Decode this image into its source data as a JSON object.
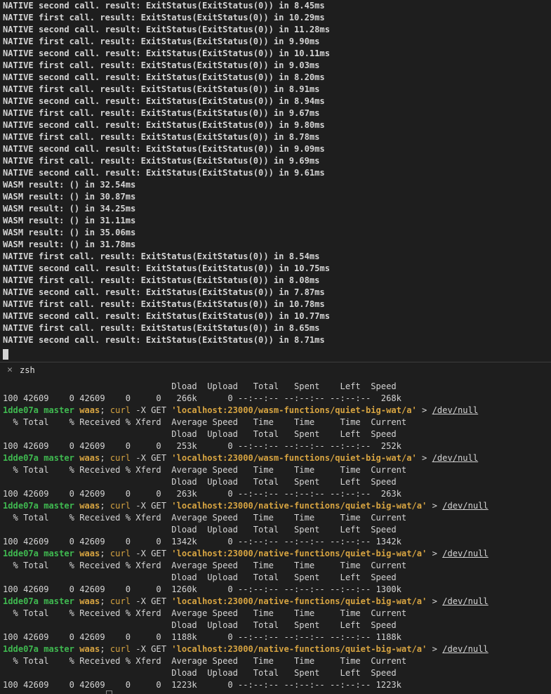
{
  "log_lines": [
    "NATIVE second call. result: ExitStatus(ExitStatus(0)) in 8.45ms",
    "NATIVE first call. result: ExitStatus(ExitStatus(0)) in 10.29ms",
    "NATIVE second call. result: ExitStatus(ExitStatus(0)) in 11.28ms",
    "NATIVE first call. result: ExitStatus(ExitStatus(0)) in 9.90ms",
    "NATIVE second call. result: ExitStatus(ExitStatus(0)) in 10.11ms",
    "NATIVE first call. result: ExitStatus(ExitStatus(0)) in 9.03ms",
    "NATIVE second call. result: ExitStatus(ExitStatus(0)) in 8.20ms",
    "NATIVE first call. result: ExitStatus(ExitStatus(0)) in 8.91ms",
    "NATIVE second call. result: ExitStatus(ExitStatus(0)) in 8.94ms",
    "NATIVE first call. result: ExitStatus(ExitStatus(0)) in 9.67ms",
    "NATIVE second call. result: ExitStatus(ExitStatus(0)) in 9.80ms",
    "NATIVE first call. result: ExitStatus(ExitStatus(0)) in 8.78ms",
    "NATIVE second call. result: ExitStatus(ExitStatus(0)) in 9.09ms",
    "NATIVE first call. result: ExitStatus(ExitStatus(0)) in 9.69ms",
    "NATIVE second call. result: ExitStatus(ExitStatus(0)) in 9.61ms",
    "WASM result: () in 32.54ms",
    "WASM result: () in 30.87ms",
    "WASM result: () in 34.25ms",
    "WASM result: () in 31.11ms",
    "WASM result: () in 35.06ms",
    "WASM result: () in 31.78ms",
    "NATIVE first call. result: ExitStatus(ExitStatus(0)) in 8.54ms",
    "NATIVE second call. result: ExitStatus(ExitStatus(0)) in 10.75ms",
    "NATIVE first call. result: ExitStatus(ExitStatus(0)) in 8.08ms",
    "NATIVE second call. result: ExitStatus(ExitStatus(0)) in 7.87ms",
    "NATIVE first call. result: ExitStatus(ExitStatus(0)) in 10.78ms",
    "NATIVE second call. result: ExitStatus(ExitStatus(0)) in 10.77ms",
    "NATIVE first call. result: ExitStatus(ExitStatus(0)) in 8.65ms",
    "NATIVE second call. result: ExitStatus(ExitStatus(0)) in 8.71ms"
  ],
  "terminal_tab": {
    "label": "zsh",
    "close_icon": "close-icon"
  },
  "curl_header_1": "  % Total    % Received % Xferd  Average Speed   Time    Time     Time  Current",
  "curl_header_2": "                                 Dload  Upload   Total   Spent    Left  Speed",
  "prompt": {
    "hash": "1dde07a",
    "branch": "master",
    "dir": "waas",
    "semicolon": ";",
    "cmd": "curl",
    "args": " -X GET ",
    "redirect": " > ",
    "target": "/dev/null"
  },
  "urls": [
    "'localhost:23000/wasm-functions/quiet-big-wat/a'",
    "'localhost:23000/wasm-functions/quiet-big-wat/a'",
    "'localhost:23000/native-functions/quiet-big-wat/a'",
    "'localhost:23000/native-functions/quiet-big-wat/a'",
    "'localhost:23000/native-functions/quiet-big-wat/a'",
    "'localhost:23000/native-functions/quiet-big-wat/a'"
  ],
  "progress_rows": [
    "100 42609    0 42609    0     0   266k      0 --:--:-- --:--:-- --:--:--  268k",
    "100 42609    0 42609    0     0   253k      0 --:--:-- --:--:-- --:--:--  252k",
    "100 42609    0 42609    0     0   263k      0 --:--:-- --:--:-- --:--:--  263k",
    "100 42609    0 42609    0     0  1342k      0 --:--:-- --:--:-- --:--:-- 1342k",
    "100 42609    0 42609    0     0  1260k      0 --:--:-- --:--:-- --:--:-- 1300k",
    "100 42609    0 42609    0     0  1188k      0 --:--:-- --:--:-- --:--:-- 1188k",
    "100 42609    0 42609    0     0  1223k      0 --:--:-- --:--:-- --:--:-- 1223k"
  ]
}
